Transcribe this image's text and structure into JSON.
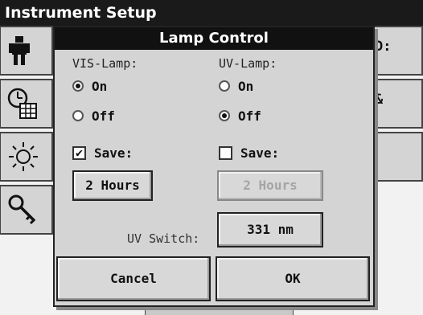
{
  "background": {
    "title": "Instrument Setup",
    "right_items": [
      "D:",
      "&"
    ]
  },
  "dialog": {
    "title": "Lamp Control",
    "vis": {
      "label": "VIS-Lamp:",
      "on_label": "On",
      "off_label": "Off",
      "selected": "On",
      "save_label": "Save:",
      "save_checked": true,
      "duration": "2 Hours"
    },
    "uv": {
      "label": "UV-Lamp:",
      "on_label": "On",
      "off_label": "Off",
      "selected": "Off",
      "save_label": "Save:",
      "save_checked": false,
      "duration": "2 Hours"
    },
    "uv_switch": {
      "label": "UV Switch:",
      "value": "331 nm"
    },
    "cancel_label": "Cancel",
    "ok_label": "OK"
  },
  "icons": {
    "checkmark": "✔"
  }
}
